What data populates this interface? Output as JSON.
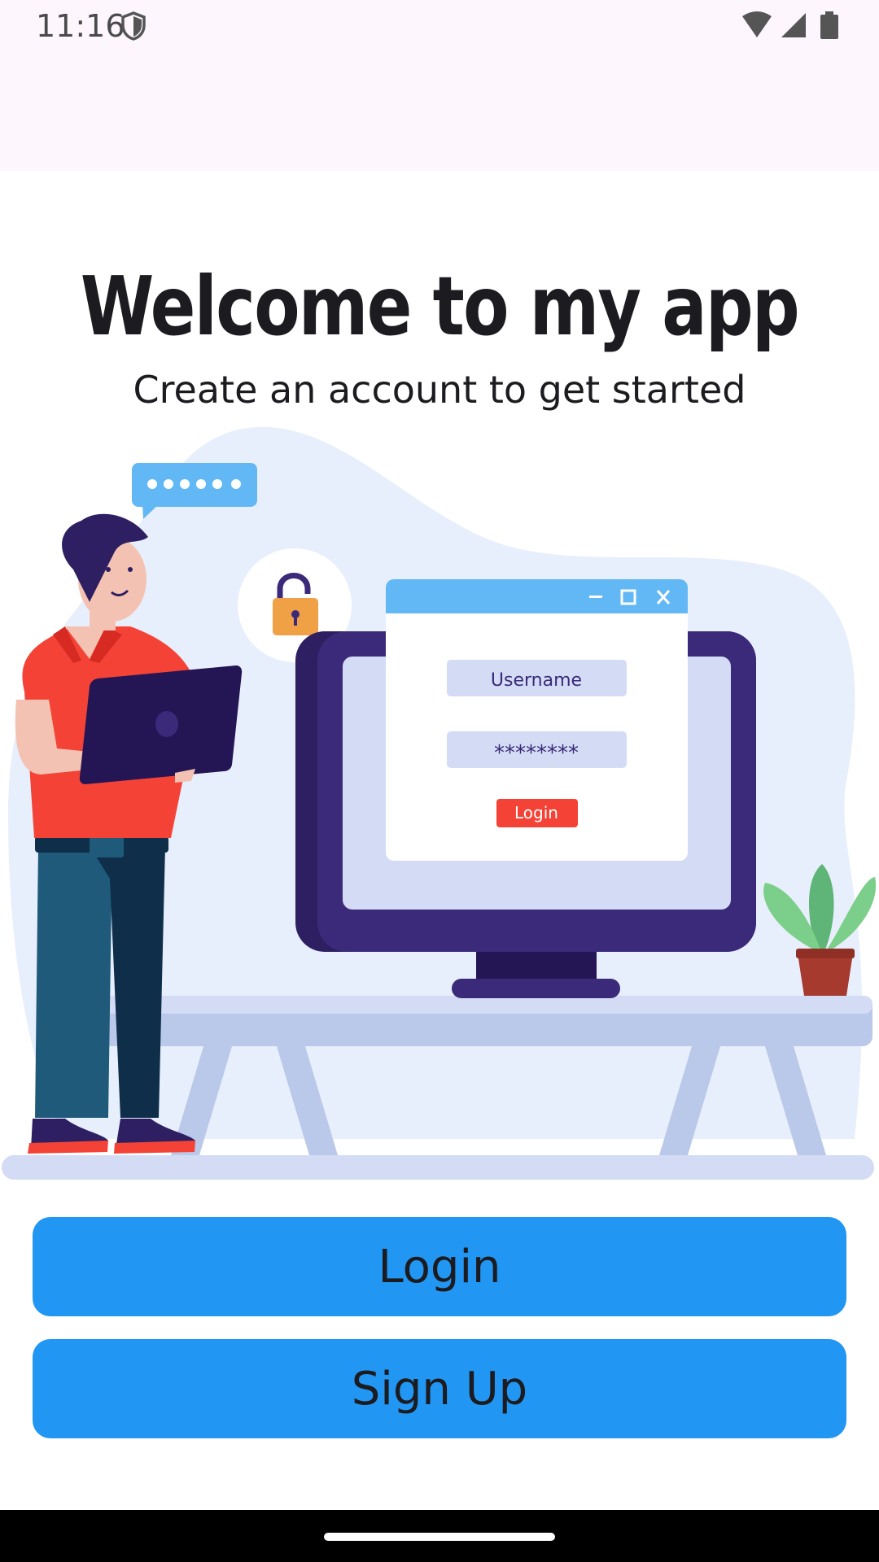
{
  "status_bar": {
    "time": "11:16",
    "icons": [
      "shield-icon",
      "wifi-icon",
      "signal-icon",
      "battery-icon"
    ]
  },
  "header": {
    "title": "Welcome to my app",
    "subtitle": "Create an account to get started"
  },
  "illustration": {
    "username_placeholder": "Username",
    "password_mask": "********",
    "login_label": "Login"
  },
  "actions": {
    "login_label": "Login",
    "signup_label": "Sign Up"
  },
  "colors": {
    "primary_button": "#2196f3",
    "status_bar_bg": "#fdf7fd",
    "nav_bar_bg": "#000000"
  }
}
